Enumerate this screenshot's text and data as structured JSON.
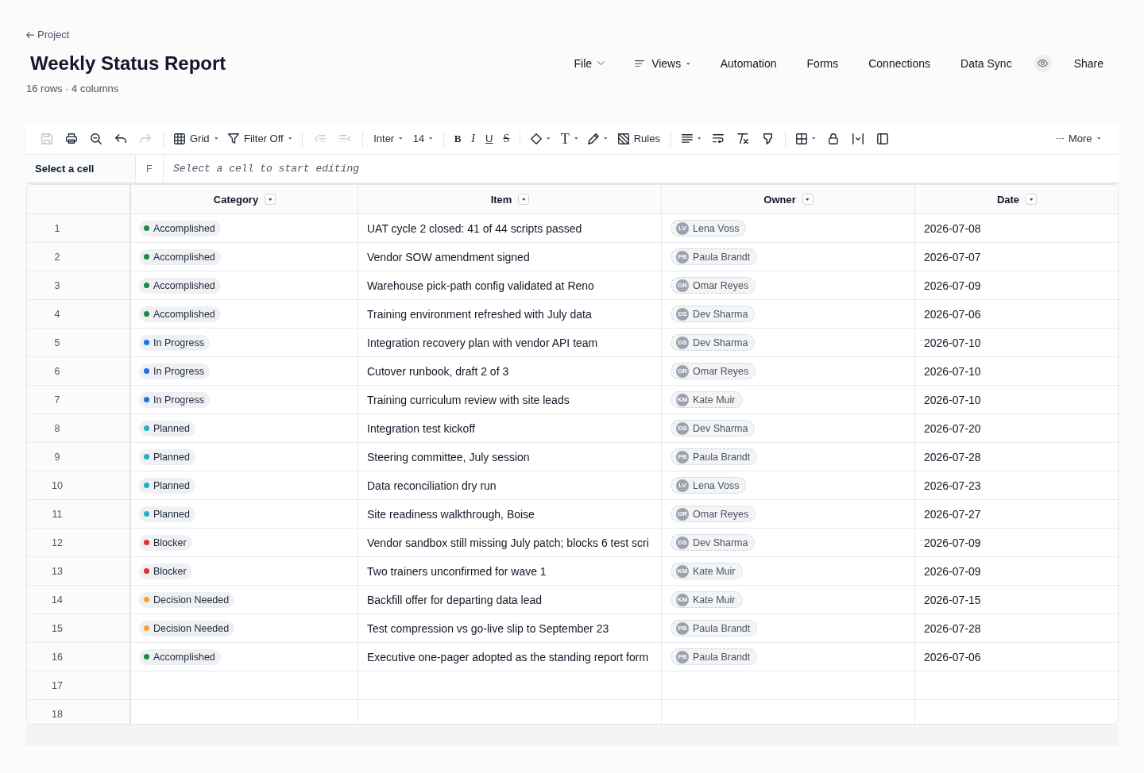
{
  "header": {
    "breadcrumb": "Project",
    "title": "Weekly Status Report",
    "subtitle": "16 rows · 4 columns",
    "nav": [
      {
        "kind": "menu",
        "label": "File"
      },
      {
        "kind": "menu",
        "label": "Views"
      },
      {
        "kind": "link",
        "label": "Automation"
      },
      {
        "kind": "link",
        "label": "Forms"
      },
      {
        "kind": "link",
        "label": "Connections"
      },
      {
        "kind": "link",
        "label": "Data Sync"
      },
      {
        "kind": "icon"
      },
      {
        "kind": "link",
        "label": "Share"
      }
    ]
  },
  "toolbar": {
    "groups": [
      [
        {
          "disabled": true,
          "dropdown": false
        },
        {
          "disabled": false,
          "dropdown": false
        },
        {
          "disabled": false,
          "dropdown": false
        },
        {
          "disabled": false,
          "dropdown": false
        },
        {
          "disabled": true,
          "dropdown": false
        }
      ],
      [
        {
          "label": "Grid",
          "disabled": false,
          "dropdown": true
        },
        {
          "label": "Filter Off",
          "disabled": false,
          "dropdown": true
        }
      ],
      [
        {
          "disabled": true,
          "dropdown": false
        },
        {
          "disabled": true,
          "dropdown": false
        }
      ],
      [
        {
          "label": "Inter",
          "disabled": false,
          "dropdown": true
        },
        {
          "label": "14",
          "disabled": false,
          "dropdown": true
        }
      ],
      [
        {
          "label": "B",
          "disabled": false,
          "dropdown": false
        },
        {
          "label": "I",
          "disabled": false,
          "dropdown": false
        },
        {
          "label": "U",
          "disabled": false,
          "dropdown": false
        },
        {
          "label": "S",
          "disabled": false,
          "dropdown": false
        }
      ],
      [
        {
          "disabled": false,
          "dropdown": true
        },
        {
          "label": "T",
          "disabled": false,
          "dropdown": true
        },
        {
          "disabled": false,
          "dropdown": true
        },
        {
          "label": "Rules",
          "disabled": false,
          "dropdown": false
        }
      ],
      [
        {
          "disabled": false,
          "dropdown": true
        },
        {
          "disabled": false,
          "dropdown": false
        },
        {
          "disabled": false,
          "dropdown": false
        },
        {
          "disabled": false,
          "dropdown": false
        }
      ],
      [
        {
          "disabled": false,
          "dropdown": true
        },
        {
          "disabled": false,
          "dropdown": false
        },
        {
          "disabled": false,
          "dropdown": false
        },
        {
          "disabled": false,
          "dropdown": false
        }
      ]
    ],
    "more": {
      "label": "More",
      "disabled": false,
      "dropdown": true
    }
  },
  "formula_bar": {
    "cell_reference": "Select a cell",
    "function_label": "F",
    "placeholder": "Select a cell to start editing"
  },
  "table": {
    "columns": [
      {
        "label": "Category"
      },
      {
        "label": "Item"
      },
      {
        "label": "Owner"
      },
      {
        "label": "Date"
      }
    ],
    "rows": [
      {
        "number": "1",
        "category": {
          "label": "Accomplished",
          "color": "#1e8a3e"
        },
        "item": "UAT cycle 2 closed: 41 of 44 scripts passed",
        "owner": {
          "initials": "LV",
          "name": "Lena Voss"
        },
        "date": "2026-07-08"
      },
      {
        "number": "2",
        "category": {
          "label": "Accomplished",
          "color": "#1e8a3e"
        },
        "item": "Vendor SOW amendment signed",
        "owner": {
          "initials": "PB",
          "name": "Paula Brandt"
        },
        "date": "2026-07-07"
      },
      {
        "number": "3",
        "category": {
          "label": "Accomplished",
          "color": "#1e8a3e"
        },
        "item": "Warehouse pick-path config validated at Reno",
        "owner": {
          "initials": "OR",
          "name": "Omar Reyes"
        },
        "date": "2026-07-09"
      },
      {
        "number": "4",
        "category": {
          "label": "Accomplished",
          "color": "#1e8a3e"
        },
        "item": "Training environment refreshed with July data",
        "owner": {
          "initials": "DS",
          "name": "Dev Sharma"
        },
        "date": "2026-07-06"
      },
      {
        "number": "5",
        "category": {
          "label": "In Progress",
          "color": "#1a73e8"
        },
        "item": "Integration recovery plan with vendor API team",
        "owner": {
          "initials": "DS",
          "name": "Dev Sharma"
        },
        "date": "2026-07-10"
      },
      {
        "number": "6",
        "category": {
          "label": "In Progress",
          "color": "#1a73e8"
        },
        "item": "Cutover runbook, draft 2 of 3",
        "owner": {
          "initials": "OR",
          "name": "Omar Reyes"
        },
        "date": "2026-07-10"
      },
      {
        "number": "7",
        "category": {
          "label": "In Progress",
          "color": "#1a73e8"
        },
        "item": "Training curriculum review with site leads",
        "owner": {
          "initials": "KM",
          "name": "Kate Muir"
        },
        "date": "2026-07-10"
      },
      {
        "number": "8",
        "category": {
          "label": "Planned",
          "color": "#1fb2c6"
        },
        "item": "Integration test kickoff",
        "owner": {
          "initials": "DS",
          "name": "Dev Sharma"
        },
        "date": "2026-07-20"
      },
      {
        "number": "9",
        "category": {
          "label": "Planned",
          "color": "#1fb2c6"
        },
        "item": "Steering committee, July session",
        "owner": {
          "initials": "PB",
          "name": "Paula Brandt"
        },
        "date": "2026-07-28"
      },
      {
        "number": "10",
        "category": {
          "label": "Planned",
          "color": "#1fb2c6"
        },
        "item": "Data reconciliation dry run",
        "owner": {
          "initials": "LV",
          "name": "Lena Voss"
        },
        "date": "2026-07-23"
      },
      {
        "number": "11",
        "category": {
          "label": "Planned",
          "color": "#1fb2c6"
        },
        "item": "Site readiness walkthrough, Boise",
        "owner": {
          "initials": "OR",
          "name": "Omar Reyes"
        },
        "date": "2026-07-27"
      },
      {
        "number": "12",
        "category": {
          "label": "Blocker",
          "color": "#e03131"
        },
        "item": "Vendor sandbox still missing July patch; blocks 6 test scri",
        "owner": {
          "initials": "DS",
          "name": "Dev Sharma"
        },
        "date": "2026-07-09"
      },
      {
        "number": "13",
        "category": {
          "label": "Blocker",
          "color": "#e03131"
        },
        "item": "Two trainers unconfirmed for wave 1",
        "owner": {
          "initials": "KM",
          "name": "Kate Muir"
        },
        "date": "2026-07-09"
      },
      {
        "number": "14",
        "category": {
          "label": "Decision Needed",
          "color": "#f5a524"
        },
        "item": "Backfill offer for departing data lead",
        "owner": {
          "initials": "KM",
          "name": "Kate Muir"
        },
        "date": "2026-07-15"
      },
      {
        "number": "15",
        "category": {
          "label": "Decision Needed",
          "color": "#f5a524"
        },
        "item": "Test compression vs go-live slip to September 23",
        "owner": {
          "initials": "PB",
          "name": "Paula Brandt"
        },
        "date": "2026-07-28"
      },
      {
        "number": "16",
        "category": {
          "label": "Accomplished",
          "color": "#1e8a3e"
        },
        "item": "Executive one-pager adopted as the standing report form",
        "owner": {
          "initials": "PB",
          "name": "Paula Brandt"
        },
        "date": "2026-07-06"
      },
      {
        "number": "17"
      },
      {
        "number": "18"
      }
    ]
  }
}
